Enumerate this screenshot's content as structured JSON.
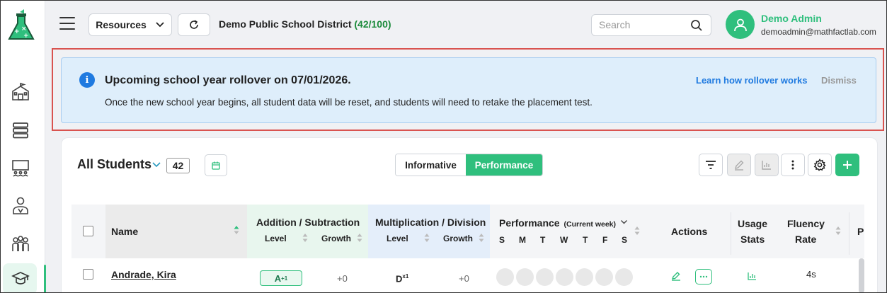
{
  "header": {
    "resources_label": "Resources",
    "district_name": "Demo Public School District",
    "district_count": "(42/100)",
    "search_placeholder": "Search",
    "user_name": "Demo Admin",
    "user_email": "demoadmin@mathfactlab.com"
  },
  "banner": {
    "title": "Upcoming school year rollover on 07/01/2026.",
    "text": "Once the new school year begins, all student data will be reset, and students will need to retake the placement test.",
    "link_label": "Learn how rollover works",
    "dismiss_label": "Dismiss"
  },
  "students": {
    "title": "All Students",
    "count": "42",
    "views": [
      {
        "label": "Informative",
        "active": false
      },
      {
        "label": "Performance",
        "active": true
      }
    ]
  },
  "table": {
    "col_name": "Name",
    "col_add": "Addition / Subtraction",
    "col_mul": "Multiplication / Division",
    "sub_level": "Level",
    "sub_growth": "Growth",
    "col_perf": "Performance",
    "col_perf_note": "(Current week)",
    "days": [
      "S",
      "M",
      "T",
      "W",
      "T",
      "F",
      "S"
    ],
    "col_actions": "Actions",
    "col_usage_1": "Usage",
    "col_usage_2": "Stats",
    "col_fluency_1": "Fluency",
    "col_fluency_2": "Rate",
    "col_cut": "P",
    "rows": [
      {
        "name": "Andrade, Kira",
        "add_level": "A",
        "add_level_sup": "+1",
        "add_growth": "+0",
        "mul_level": "D",
        "mul_level_sup": "x1",
        "mul_growth": "+0",
        "fluency": "4s"
      }
    ]
  }
}
